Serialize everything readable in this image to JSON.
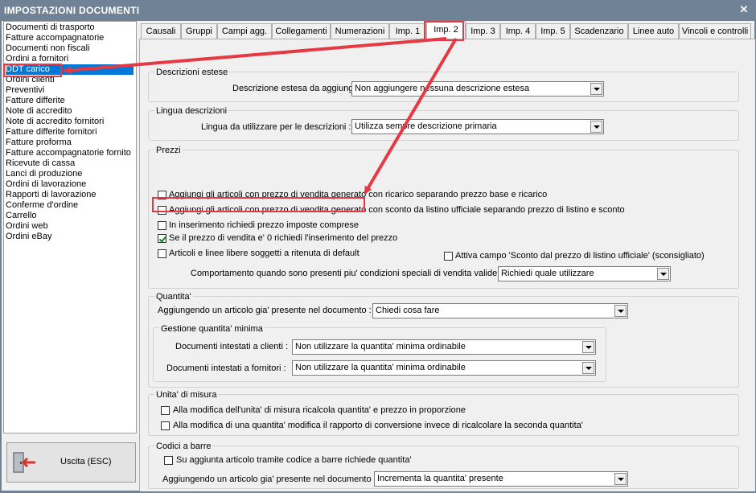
{
  "window": {
    "title": "IMPOSTAZIONI DOCUMENTI",
    "close_glyph": "✕"
  },
  "doclist": {
    "items": [
      "Documenti di trasporto",
      "Fatture accompagnatorie",
      "Documenti non fiscali",
      "Ordini a fornitori",
      "DDT carico",
      "Ordini clienti",
      "Preventivi",
      "Fatture differite",
      "Note di accredito",
      "Note di accredito fornitori",
      "Fatture differite fornitori",
      "Fatture proforma",
      "Fatture accompagnatorie fornito",
      "Ricevute di cassa",
      "Lanci di produzione",
      "Ordini di lavorazione",
      "Rapporti di lavorazione",
      "Conferme d'ordine",
      "Carrello",
      "Ordini web",
      "Ordini eBay"
    ],
    "selected_index": 4
  },
  "exit_button": {
    "label": "Uscita (ESC)",
    "icon": "exit-door-icon"
  },
  "tabs": [
    "Causali",
    "Gruppi",
    "Campi agg.",
    "Collegamenti",
    "Numerazioni",
    "Imp. 1",
    "Imp. 2",
    "Imp. 3",
    "Imp. 4",
    "Imp. 5",
    "Scadenzario",
    "Linee auto",
    "Vincoli e controlli"
  ],
  "active_tab_index": 6,
  "descr_estese": {
    "title": "Descrizioni estese",
    "label": "Descrizione estesa da aggiungere :",
    "value": "Non aggiungere nessuna descrizione estesa"
  },
  "lingua": {
    "title": "Lingua descrizioni",
    "label": "Lingua da utilizzare per le descrizioni :",
    "value": "Utilizza sempre descrizione primaria"
  },
  "prezzi": {
    "title": "Prezzi",
    "cb1": "Aggiungi gli articoli con prezzo di vendita generato con ricarico separando prezzo base e ricarico",
    "cb2": "Aggiungi gli articoli con prezzo di vendita generato con sconto da listino ufficiale separando prezzo di listino e sconto",
    "cb3": "In inserimento richiedi prezzo imposte comprese",
    "cb4": "Se il prezzo di vendita e' 0 richiedi l'inserimento del prezzo",
    "cb5": "Articoli e linee libere soggetti a ritenuta di default",
    "cb6": "Attiva campo 'Sconto dal prezzo di listino ufficiale' (sconsigliato)",
    "cond_label": "Comportamento quando sono presenti piu' condizioni speciali di vendita valide :",
    "cond_value": "Richiedi quale utilizzare"
  },
  "quantita": {
    "title": "Quantita'",
    "label": "Aggiungendo un articolo gia' presente nel documento :",
    "value": "Chiedi cosa fare",
    "min_title": "Gestione quantita' minima",
    "clienti_label": "Documenti intestati a clienti :",
    "clienti_value": "Non utilizzare la quantita' minima ordinabile",
    "fornitori_label": "Documenti intestati a fornitori :",
    "fornitori_value": "Non utilizzare la quantita' minima ordinabile"
  },
  "unita": {
    "title": "Unita' di misura",
    "cb1": "Alla modifica dell'unita' di misura ricalcola quantita' e prezzo in proporzione",
    "cb2": "Alla modifica di una quantita' modifica il rapporto di conversione invece di ricalcolare la seconda quantita'"
  },
  "codici": {
    "title": "Codici a barre",
    "cb1": "Su aggiunta articolo tramite codice a barre richiede quantita'",
    "label": "Aggiungendo un articolo gia' presente nel documento :",
    "value": "Incrementa la quantita' presente"
  },
  "colors": {
    "title_bar": "#6f8296",
    "selection": "#0078d7",
    "highlight": "#e63946",
    "check": "#1a7f1a"
  }
}
